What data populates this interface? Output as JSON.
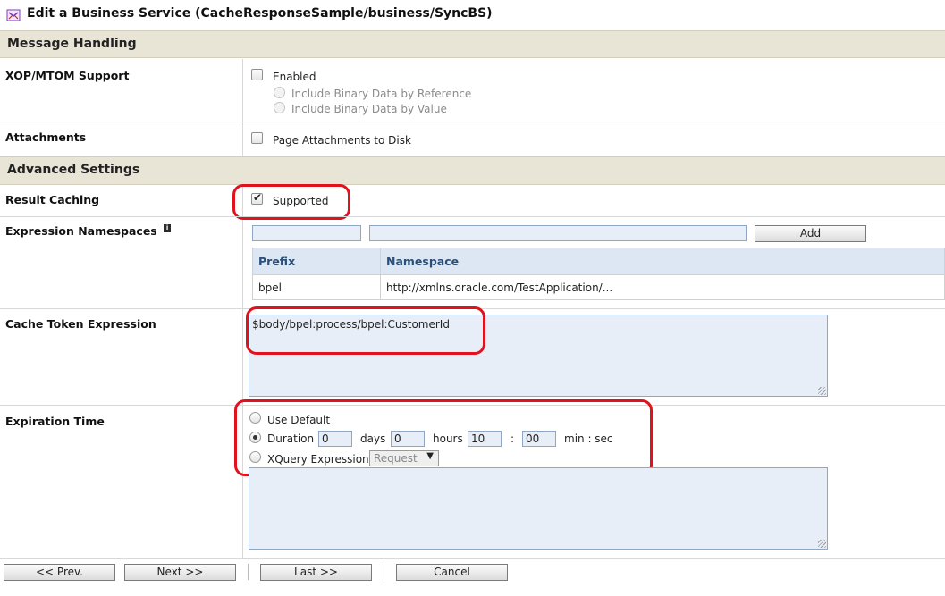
{
  "title": "Edit a Business Service (CacheResponseSample/business/SyncBS)",
  "sections": {
    "message_handling": "Message Handling",
    "advanced_settings": "Advanced Settings"
  },
  "xop": {
    "label": "XOP/MTOM Support",
    "enabled_label": "Enabled",
    "option_reference": "Include Binary Data by Reference",
    "option_value": "Include Binary Data by Value"
  },
  "attachments": {
    "label": "Attachments",
    "page_to_disk_label": "Page Attachments to Disk"
  },
  "result_caching": {
    "label": "Result Caching",
    "supported_label": "Supported",
    "checked": true
  },
  "expression_namespaces": {
    "label": "Expression Namespaces",
    "info_glyph": "i",
    "prefix_input": "",
    "namespace_input": "",
    "add_button": "Add",
    "columns": [
      "Prefix",
      "Namespace"
    ],
    "rows": [
      [
        "bpel",
        "http://xmlns.oracle.com/TestApplication/..."
      ]
    ]
  },
  "cache_token": {
    "label": "Cache Token Expression",
    "value": "$body/bpel:process/bpel:CustomerId"
  },
  "expiration": {
    "label": "Expiration Time",
    "use_default_label": "Use Default",
    "duration_label": "Duration",
    "days_value": "0",
    "days_label": "days",
    "hours_value": "0",
    "hours_label": "hours",
    "min_value": "10",
    "colon": ":",
    "sec_value": "00",
    "min_sec_label": "min : sec",
    "xquery_label": "XQuery Expression",
    "xquery_select": "Request",
    "selected_option": "Duration",
    "xquery_text": ""
  },
  "footer": {
    "prev": "<< Prev.",
    "next": "Next >>",
    "last": "Last >>",
    "cancel": "Cancel"
  },
  "colors": {
    "section_bg": "#e9e5d6",
    "table_header_bg": "#dde7f3",
    "input_bg": "#e8eef8",
    "highlight": "#e0121d"
  }
}
